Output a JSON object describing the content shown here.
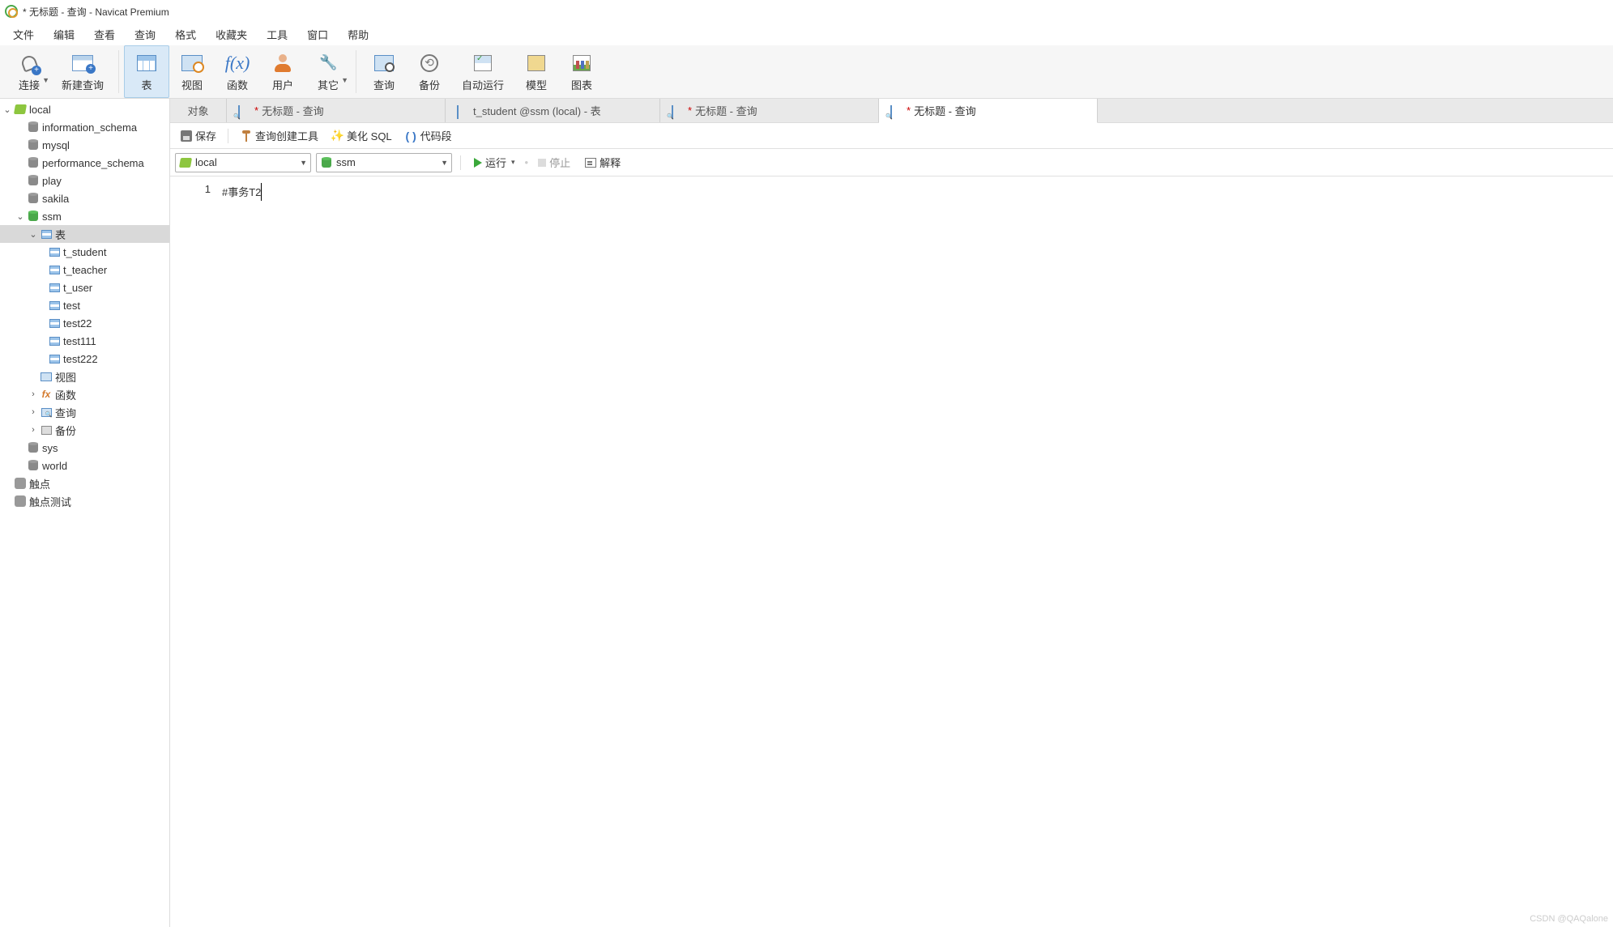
{
  "window": {
    "title": "* 无标题 - 查询 - Navicat Premium"
  },
  "menu": {
    "items": [
      "文件",
      "编辑",
      "查看",
      "查询",
      "格式",
      "收藏夹",
      "工具",
      "窗口",
      "帮助"
    ]
  },
  "toolbar": {
    "items": [
      {
        "id": "connect",
        "label": "连接"
      },
      {
        "id": "newquery",
        "label": "新建查询"
      },
      {
        "id": "table",
        "label": "表",
        "active": true
      },
      {
        "id": "view",
        "label": "视图"
      },
      {
        "id": "function",
        "label": "函数"
      },
      {
        "id": "user",
        "label": "用户"
      },
      {
        "id": "other",
        "label": "其它"
      },
      {
        "id": "query",
        "label": "查询"
      },
      {
        "id": "backup",
        "label": "备份"
      },
      {
        "id": "autorun",
        "label": "自动运行"
      },
      {
        "id": "model",
        "label": "模型"
      },
      {
        "id": "chart",
        "label": "图表"
      }
    ]
  },
  "tree": {
    "conn": "local",
    "dbs": [
      "information_schema",
      "mysql",
      "performance_schema",
      "play",
      "sakila"
    ],
    "open_db": "ssm",
    "folders": {
      "tables": "表",
      "views": "视图",
      "functions": "函数",
      "queries": "查询",
      "backups": "备份"
    },
    "tables": [
      "t_student",
      "t_teacher",
      "t_user",
      "test",
      "test22",
      "test111",
      "test222"
    ],
    "tail_dbs": [
      "sys",
      "world"
    ],
    "extra": [
      "触点",
      "触点测试"
    ]
  },
  "tabs": {
    "items": [
      {
        "icon": "obj",
        "label": "对象",
        "modified": false
      },
      {
        "icon": "qry",
        "label": "无标题 - 查询",
        "modified": true
      },
      {
        "icon": "tbl",
        "label": "t_student @ssm (local) - 表",
        "modified": false
      },
      {
        "icon": "qry",
        "label": "无标题 - 查询",
        "modified": true
      },
      {
        "icon": "qry",
        "label": "无标题 - 查询",
        "modified": true,
        "active": true
      }
    ]
  },
  "qtoolbar": {
    "save": "保存",
    "builder": "查询创建工具",
    "beautify": "美化 SQL",
    "snippet": "代码段"
  },
  "combos": {
    "conn": "local",
    "db": "ssm"
  },
  "runbar": {
    "run": "运行",
    "stop": "停止",
    "explain": "解释"
  },
  "editor": {
    "line_no": "1",
    "code": "#事务T2"
  },
  "watermark": "CSDN @QAQalone"
}
